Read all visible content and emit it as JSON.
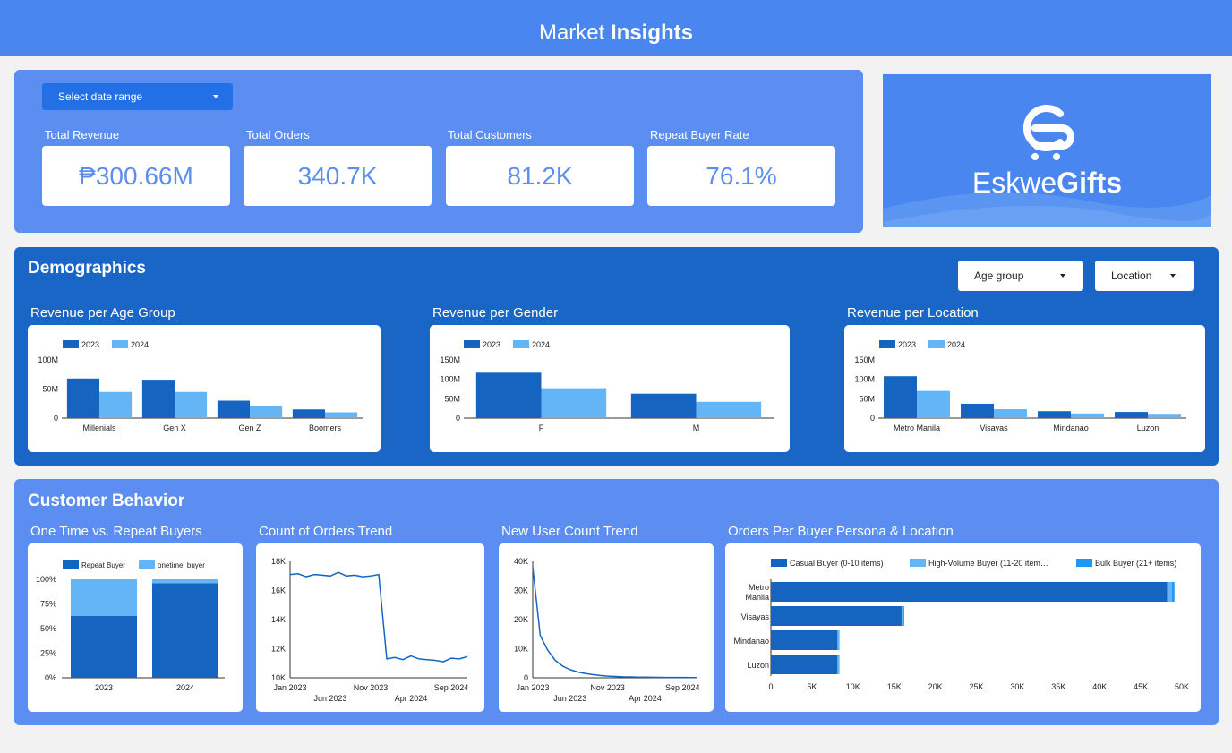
{
  "header": {
    "title_light": "Market",
    "title_bold": "Insights"
  },
  "date_select": {
    "label": "Select date range",
    "icon": "caret-down-icon"
  },
  "kpis": [
    {
      "label": "Total Revenue",
      "value": "₱300.66M"
    },
    {
      "label": "Total Orders",
      "value": "340.7K"
    },
    {
      "label": "Total Customers",
      "value": "81.2K"
    },
    {
      "label": "Repeat Buyer Rate",
      "value": "76.1%"
    }
  ],
  "logo": {
    "name_light": "Eskwe",
    "name_bold": "Gifts",
    "icon": "eskwegifts-logo-icon"
  },
  "demographics": {
    "title": "Demographics",
    "filters": [
      {
        "label": "Age group",
        "icon": "caret-down-icon"
      },
      {
        "label": "Location",
        "icon": "caret-down-icon"
      }
    ],
    "charts": [
      {
        "title": "Revenue per Age Group"
      },
      {
        "title": "Revenue per Gender"
      },
      {
        "title": "Revenue per Location"
      }
    ]
  },
  "behavior": {
    "title": "Customer Behavior",
    "charts": [
      {
        "title": "One Time vs. Repeat Buyers"
      },
      {
        "title": "Count of Orders Trend"
      },
      {
        "title": "New User Count Trend"
      },
      {
        "title": "Orders Per Buyer Persona & Location"
      }
    ]
  },
  "colors": {
    "dark_blue": "#1565c0",
    "light_blue": "#64b5f6",
    "mid_blue": "#2196f3",
    "line_blue": "#1565c0"
  },
  "chart_data": [
    {
      "type": "bar",
      "title": "Revenue per Age Group",
      "categories": [
        "Millenials",
        "Gen X",
        "Gen Z",
        "Boomers"
      ],
      "series": [
        {
          "name": "2023",
          "values": [
            68,
            66,
            30,
            15
          ]
        },
        {
          "name": "2024",
          "values": [
            45,
            45,
            20,
            10
          ]
        }
      ],
      "ylim": [
        0,
        100
      ],
      "yticks": [
        "0",
        "50M",
        "100M"
      ],
      "legend": "top-left"
    },
    {
      "type": "bar",
      "title": "Revenue per Gender",
      "categories": [
        "F",
        "M"
      ],
      "series": [
        {
          "name": "2023",
          "values": [
            117,
            63
          ]
        },
        {
          "name": "2024",
          "values": [
            77,
            42
          ]
        }
      ],
      "ylim": [
        0,
        150
      ],
      "yticks": [
        "0",
        "50M",
        "100M",
        "150M"
      ],
      "legend": "top-left"
    },
    {
      "type": "bar",
      "title": "Revenue per Location",
      "categories": [
        "Metro Manila",
        "Visayas",
        "Mindanao",
        "Luzon"
      ],
      "series": [
        {
          "name": "2023",
          "values": [
            108,
            37,
            18,
            16
          ]
        },
        {
          "name": "2024",
          "values": [
            70,
            23,
            12,
            11
          ]
        }
      ],
      "ylim": [
        0,
        150
      ],
      "yticks": [
        "0",
        "50M",
        "100M",
        "150M"
      ],
      "legend": "top-left"
    },
    {
      "type": "bar",
      "stacked": true,
      "title": "One Time vs. Repeat Buyers",
      "categories": [
        "2023",
        "2024"
      ],
      "series": [
        {
          "name": "Repeat Buyer",
          "values": [
            63,
            96
          ]
        },
        {
          "name": "onetime_buyer",
          "values": [
            37,
            4
          ]
        }
      ],
      "ylim": [
        0,
        100
      ],
      "yticks": [
        "0%",
        "25%",
        "50%",
        "75%",
        "100%"
      ],
      "legend": "top-left"
    },
    {
      "type": "line",
      "title": "Count of Orders Trend",
      "x": [
        "2023-01",
        "2023-02",
        "2023-03",
        "2023-04",
        "2023-05",
        "2023-06",
        "2023-07",
        "2023-08",
        "2023-09",
        "2023-10",
        "2023-11",
        "2023-12",
        "2024-01",
        "2024-02",
        "2024-03",
        "2024-04",
        "2024-05",
        "2024-06",
        "2024-07",
        "2024-08",
        "2024-09",
        "2024-10",
        "2024-11"
      ],
      "y": [
        17100,
        17150,
        16950,
        17100,
        17050,
        17000,
        17250,
        17000,
        17050,
        16950,
        17000,
        17100,
        11300,
        11400,
        11250,
        11500,
        11300,
        11250,
        11200,
        11100,
        11350,
        11300,
        11450
      ],
      "ylim": [
        10000,
        18000
      ],
      "yticks": [
        "10K",
        "12K",
        "14K",
        "16K",
        "18K"
      ],
      "xticks_top": [
        "Jan 2023",
        "Nov 2023",
        "Sep 2024"
      ],
      "xticks_bottom": [
        "Jun 2023",
        "Apr 2024"
      ]
    },
    {
      "type": "line",
      "title": "New User Count Trend",
      "x": [
        "2023-01",
        "2023-02",
        "2023-03",
        "2023-04",
        "2023-05",
        "2023-06",
        "2023-07",
        "2023-08",
        "2023-09",
        "2023-10",
        "2023-11",
        "2023-12",
        "2024-01",
        "2024-02",
        "2024-03",
        "2024-04",
        "2024-05",
        "2024-06",
        "2024-07",
        "2024-08",
        "2024-09",
        "2024-10",
        "2024-11"
      ],
      "y": [
        38000,
        14500,
        9500,
        6000,
        4000,
        2800,
        2000,
        1500,
        1100,
        800,
        600,
        450,
        350,
        300,
        250,
        200,
        180,
        150,
        130,
        120,
        110,
        100,
        100
      ],
      "ylim": [
        0,
        40000
      ],
      "yticks": [
        "0",
        "10K",
        "20K",
        "30K",
        "40K"
      ],
      "xticks_top": [
        "Jan 2023",
        "Nov 2023",
        "Sep 2024"
      ],
      "xticks_bottom": [
        "Jun 2023",
        "Apr 2024"
      ]
    },
    {
      "type": "bar",
      "orientation": "horizontal",
      "stacked": true,
      "title": "Orders Per Buyer Persona & Location",
      "categories": [
        "Metro Manila",
        "Visayas",
        "Mindanao",
        "Luzon"
      ],
      "category_lines": [
        [
          "Metro",
          "Manila"
        ],
        [
          "Visayas"
        ],
        [
          "Mindanao"
        ],
        [
          "Luzon"
        ]
      ],
      "series": [
        {
          "name": "Casual Buyer (0-10 items)",
          "values": [
            48200,
            15900,
            8100,
            8100
          ]
        },
        {
          "name": "High-Volume Buyer (11-20 item…",
          "values": [
            600,
            200,
            150,
            150
          ]
        },
        {
          "name": "Bulk Buyer (21+ items)",
          "values": [
            300,
            120,
            80,
            80
          ]
        }
      ],
      "xlim": [
        0,
        50000
      ],
      "xticks": [
        "0",
        "5K",
        "10K",
        "15K",
        "20K",
        "25K",
        "30K",
        "35K",
        "40K",
        "45K",
        "50K"
      ],
      "legend": "top"
    }
  ]
}
